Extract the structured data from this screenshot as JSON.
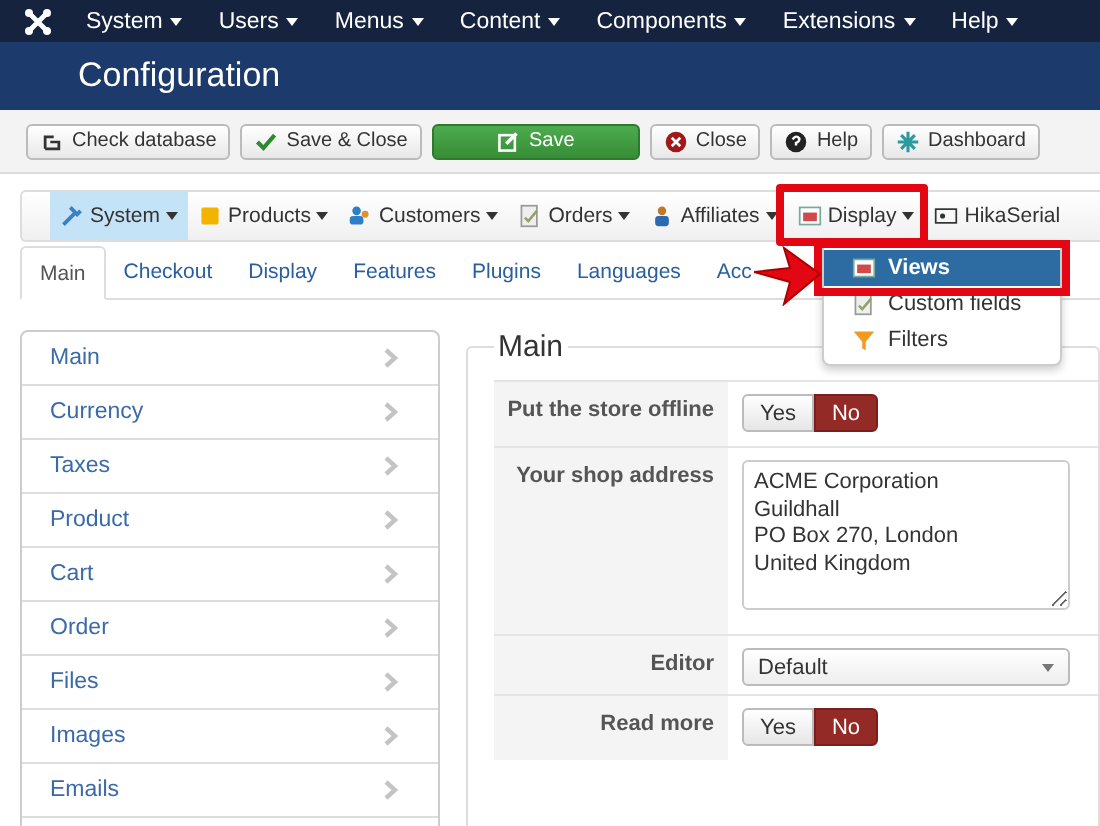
{
  "top_menu": [
    {
      "label": "System"
    },
    {
      "label": "Users"
    },
    {
      "label": "Menus"
    },
    {
      "label": "Content"
    },
    {
      "label": "Components"
    },
    {
      "label": "Extensions"
    },
    {
      "label": "Help"
    }
  ],
  "page_title": "Configuration",
  "toolbar": [
    {
      "label": "Check database",
      "kind": "default"
    },
    {
      "label": "Save & Close",
      "kind": "default"
    },
    {
      "label": "Save",
      "kind": "primary"
    },
    {
      "label": "Close",
      "kind": "default"
    },
    {
      "label": "Help",
      "kind": "default"
    },
    {
      "label": "Dashboard",
      "kind": "default"
    }
  ],
  "shop_menu": [
    {
      "label": "System",
      "selected": true,
      "highlighted": false
    },
    {
      "label": "Products",
      "selected": false,
      "highlighted": false
    },
    {
      "label": "Customers",
      "selected": false,
      "highlighted": false
    },
    {
      "label": "Orders",
      "selected": false,
      "highlighted": false
    },
    {
      "label": "Affiliates",
      "selected": false,
      "highlighted": false
    },
    {
      "label": "Display",
      "selected": false,
      "highlighted": true
    },
    {
      "label": "HikaSerial",
      "selected": false,
      "highlighted": false
    }
  ],
  "dropdown": [
    {
      "label": "Views",
      "selected": true,
      "highlighted": true
    },
    {
      "label": "Custom fields",
      "selected": false,
      "highlighted": false
    },
    {
      "label": "Filters",
      "selected": false,
      "highlighted": false
    }
  ],
  "tabs": [
    {
      "label": "Main",
      "selected": true
    },
    {
      "label": "Checkout",
      "selected": false
    },
    {
      "label": "Display",
      "selected": false
    },
    {
      "label": "Features",
      "selected": false
    },
    {
      "label": "Plugins",
      "selected": false
    },
    {
      "label": "Languages",
      "selected": false
    },
    {
      "label": "Acc",
      "selected": false
    }
  ],
  "sidebar": [
    {
      "label": "Main"
    },
    {
      "label": "Currency"
    },
    {
      "label": "Taxes"
    },
    {
      "label": "Product"
    },
    {
      "label": "Cart"
    },
    {
      "label": "Order"
    },
    {
      "label": "Files"
    },
    {
      "label": "Images"
    },
    {
      "label": "Emails"
    }
  ],
  "section": {
    "legend": "Main",
    "fields": [
      {
        "label": "Put the store offline",
        "kind": "toggle",
        "options": [
          {
            "label": "Yes",
            "selected": false
          },
          {
            "label": "No",
            "selected": true
          }
        ]
      },
      {
        "label": "Your shop address",
        "kind": "textarea",
        "value": "ACME Corporation\nGuildhall\nPO Box 270, London\nUnited Kingdom"
      },
      {
        "label": "Editor",
        "kind": "select",
        "value": "Default"
      },
      {
        "label": "Read more",
        "kind": "toggle",
        "options": [
          {
            "label": "Yes",
            "selected": false
          },
          {
            "label": "No",
            "selected": true
          }
        ]
      }
    ]
  }
}
